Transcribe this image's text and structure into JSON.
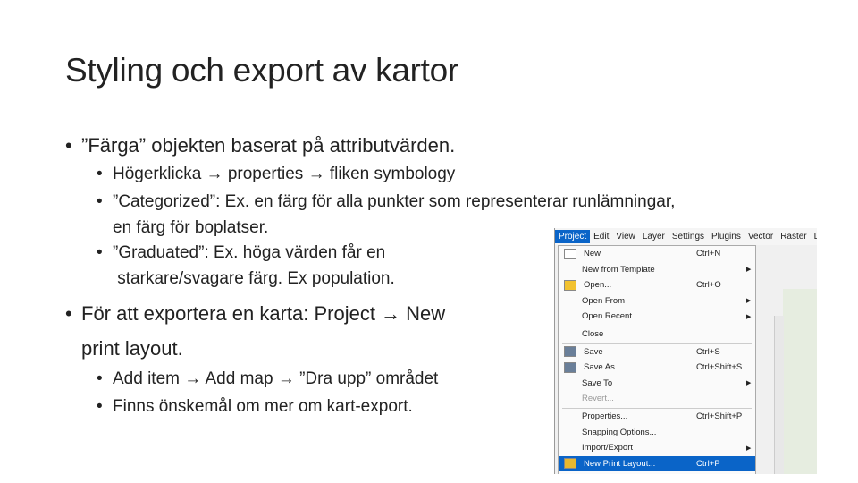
{
  "slide": {
    "title": "Styling och export av kartor",
    "bullets": [
      {
        "level": 1,
        "text": "”Färga” objekten baserat på attributvärden."
      },
      {
        "level": 2,
        "text": "Högerklicka → properties → fliken symbology"
      },
      {
        "level": 2,
        "text": "”Categorized”: Ex. en färg för alla punkter som representerar runlämningar,"
      },
      {
        "level": 2,
        "text": "en färg för boplatser.",
        "cont": true
      },
      {
        "level": 2,
        "text": "”Graduated”: Ex. höga värden får en"
      },
      {
        "level": 2,
        "text": " starkare/svagare färg. Ex population.",
        "cont": true
      },
      {
        "level": 1,
        "text": "För att exportera en karta: Project → New"
      },
      {
        "level": 1,
        "text": "print layout.",
        "cont": true
      },
      {
        "level": 2,
        "text": "Add item → Add map → ”Dra upp” området"
      },
      {
        "level": 2,
        "text": "Finns önskemål om mer om kart-export."
      }
    ]
  },
  "screenshot": {
    "menubar": [
      "Project",
      "Edit",
      "View",
      "Layer",
      "Settings",
      "Plugins",
      "Vector",
      "Raster",
      "Da"
    ],
    "menu": [
      {
        "label": "New",
        "shortcut": "Ctrl+N",
        "icon": "new-file-icon"
      },
      {
        "label": "New from Template",
        "submenu": true
      },
      {
        "label": "Open...",
        "shortcut": "Ctrl+O",
        "icon": "folder-icon"
      },
      {
        "label": "Open From",
        "submenu": true
      },
      {
        "label": "Open Recent",
        "submenu": true,
        "sep_after": true
      },
      {
        "label": "Close",
        "sep_after": true
      },
      {
        "label": "Save",
        "shortcut": "Ctrl+S",
        "icon": "save-icon"
      },
      {
        "label": "Save As...",
        "shortcut": "Ctrl+Shift+S",
        "icon": "save-as-icon"
      },
      {
        "label": "Save To",
        "submenu": true
      },
      {
        "label": "Revert...",
        "disabled": true,
        "sep_after": true
      },
      {
        "label": "Properties...",
        "shortcut": "Ctrl+Shift+P"
      },
      {
        "label": "Snapping Options..."
      },
      {
        "label": "Import/Export",
        "submenu": true
      },
      {
        "label": "New Print Layout...",
        "shortcut": "Ctrl+P",
        "highlighted": true,
        "icon": "print-layout-icon"
      }
    ],
    "accent": "#0a64c8"
  }
}
